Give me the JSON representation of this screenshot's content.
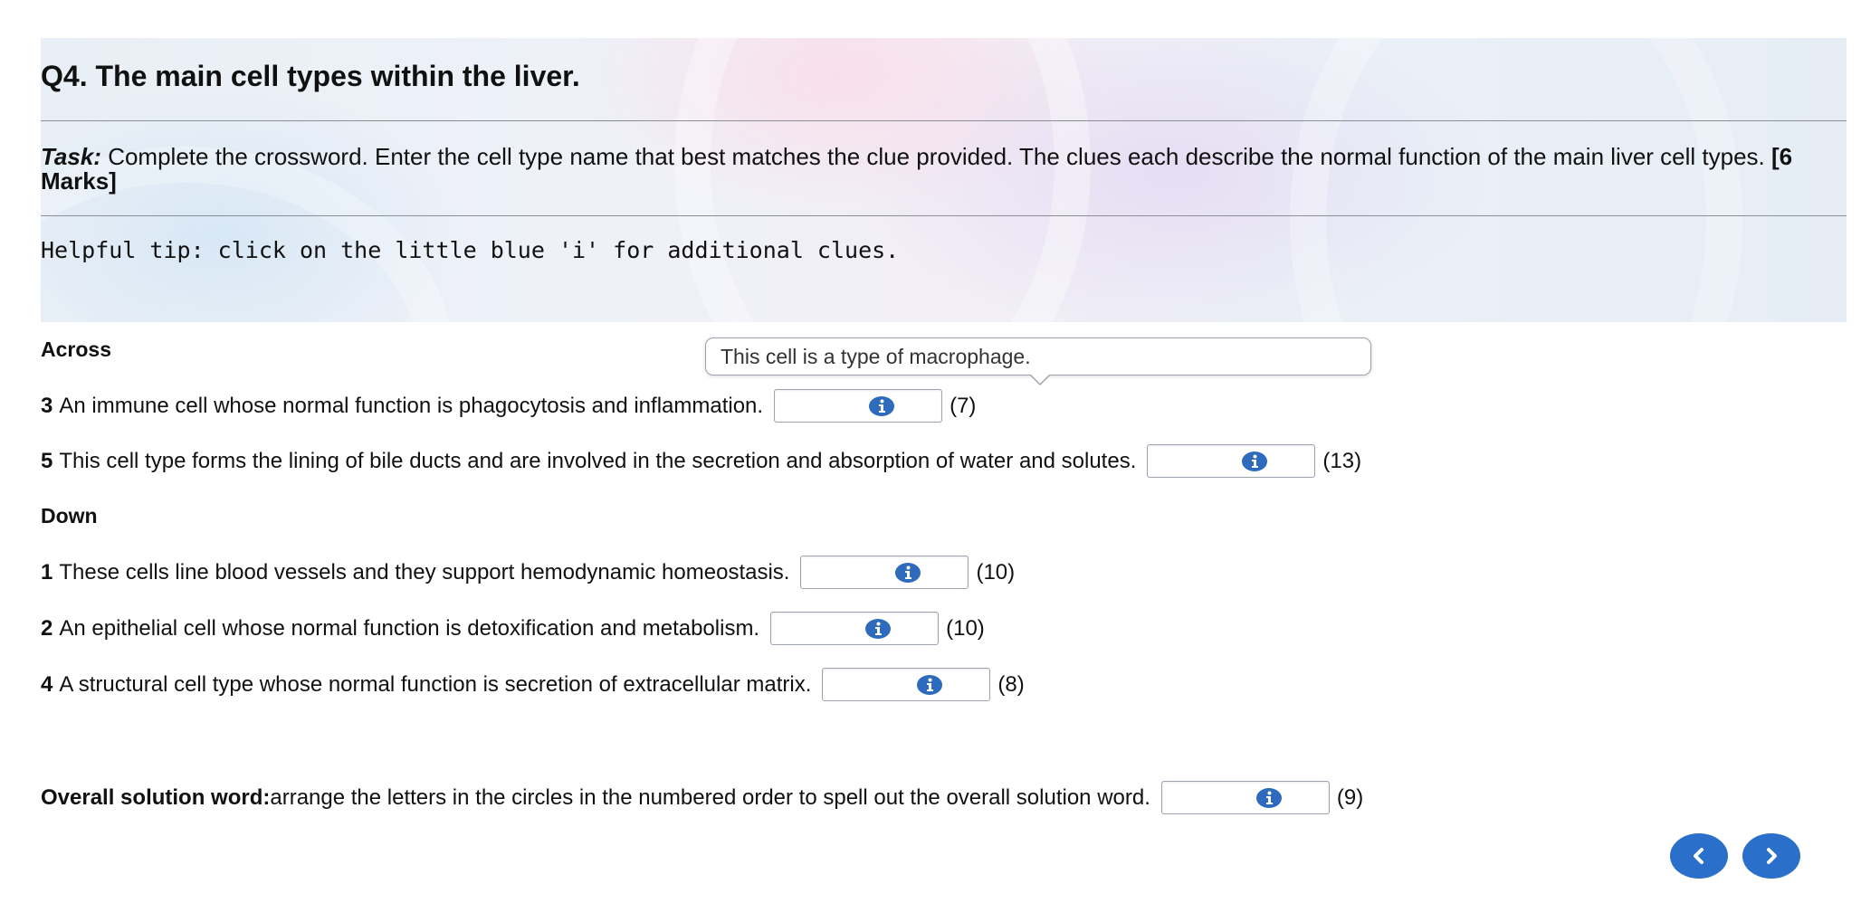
{
  "question": {
    "title": "Q4. The main cell types within the liver.",
    "task_label": "Task:",
    "task_text": " Complete the crossword. Enter the cell type name that best matches the clue provided. The clues each describe the normal function of the main liver cell types. ",
    "marks": "[6 Marks]",
    "tip": "Helpful tip: click on the little blue 'i' for additional clues."
  },
  "tooltip": {
    "text": "This cell is a type of macrophage."
  },
  "across": {
    "label": "Across",
    "clues": [
      {
        "number": "3",
        "text": "An immune cell whose normal function is phagocytosis and inflammation.",
        "value": "",
        "length": "(7)"
      },
      {
        "number": "5",
        "text": "This cell type forms the lining of bile ducts and are involved in the secretion and absorption of water and solutes.",
        "value": "",
        "length": "(13)"
      }
    ]
  },
  "down": {
    "label": "Down",
    "clues": [
      {
        "number": "1",
        "text": "These cells line blood vessels and they support hemodynamic homeostasis.",
        "value": "",
        "length": "(10)"
      },
      {
        "number": "2",
        "text": "An epithelial cell whose normal function is detoxification and metabolism.",
        "value": "",
        "length": "(10)"
      },
      {
        "number": "4",
        "text": "A structural cell type whose normal function is secretion of extracellular matrix.",
        "value": "",
        "length": "(8)"
      }
    ]
  },
  "solution": {
    "label": "Overall solution word:",
    "text": " arrange the letters in the circles in the numbered order to spell out the overall solution word.",
    "value": "",
    "length": "(9)"
  },
  "icons": {
    "info": "info-icon",
    "prev": "chevron-left-icon",
    "next": "chevron-right-icon"
  },
  "colors": {
    "accent": "#2a6fc9",
    "info_icon": "#2f6bbd"
  }
}
